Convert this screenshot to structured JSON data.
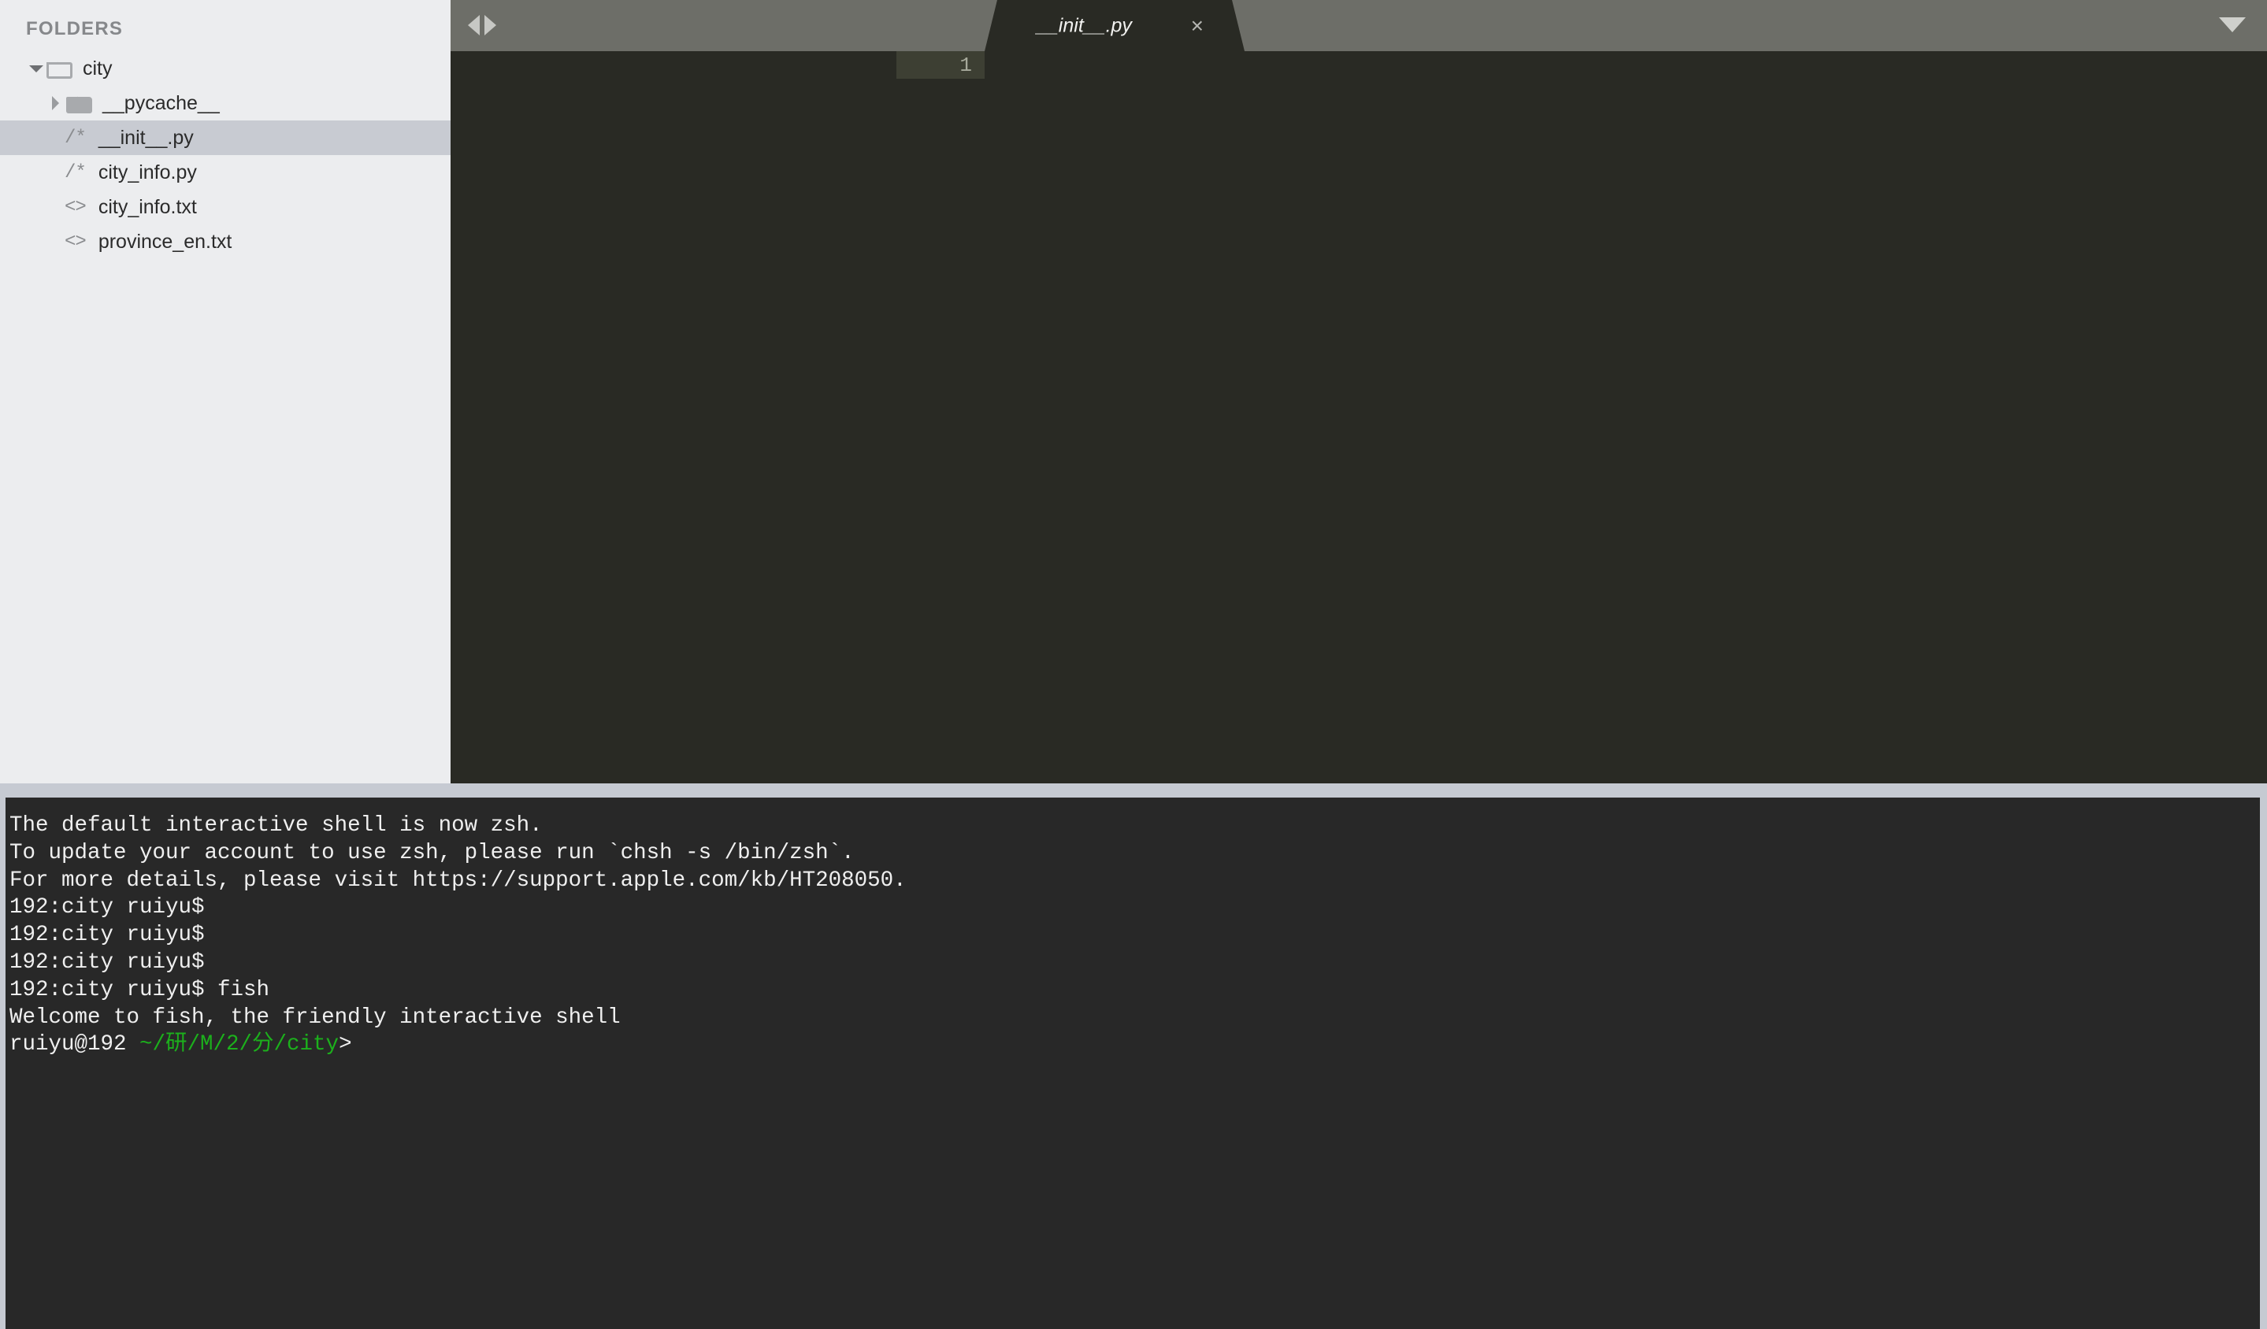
{
  "sidebar": {
    "header": "FOLDERS",
    "tree": [
      {
        "label": "city",
        "type": "folder",
        "state": "open",
        "indent": 1,
        "icon": "folder-open-icon",
        "selected": false
      },
      {
        "label": "__pycache__",
        "type": "folder",
        "state": "closed",
        "indent": 2,
        "icon": "folder-closed-icon",
        "selected": false
      },
      {
        "label": "__init__.py",
        "type": "file",
        "glyph": "/*",
        "indent": 3,
        "icon": "python-file-icon",
        "selected": true
      },
      {
        "label": "city_info.py",
        "type": "file",
        "glyph": "/*",
        "indent": 3,
        "icon": "python-file-icon",
        "selected": false
      },
      {
        "label": "city_info.txt",
        "type": "file",
        "glyph": "<>",
        "indent": 3,
        "icon": "text-file-icon",
        "selected": false
      },
      {
        "label": "province_en.txt",
        "type": "file",
        "glyph": "<>",
        "indent": 3,
        "icon": "text-file-icon",
        "selected": false
      }
    ]
  },
  "tabbar": {
    "nav_back_icon": "arrow-left-icon",
    "nav_forward_icon": "arrow-right-icon",
    "menu_icon": "chevron-down-icon",
    "tabs": [
      {
        "label": "__init__.py",
        "active": true,
        "close_glyph": "×"
      }
    ]
  },
  "editor": {
    "gutter": {
      "line_number": "1"
    },
    "content": ""
  },
  "terminal": {
    "lines": [
      {
        "segments": [
          {
            "text": "The default interactive shell is now zsh.",
            "color": "white"
          }
        ]
      },
      {
        "segments": [
          {
            "text": "To update your account to use zsh, please run `chsh -s /bin/zsh`.",
            "color": "white"
          }
        ]
      },
      {
        "segments": [
          {
            "text": "For more details, please visit https://support.apple.com/kb/HT208050.",
            "color": "white"
          }
        ]
      },
      {
        "segments": [
          {
            "text": "192:city ruiyu$ ",
            "color": "white"
          }
        ]
      },
      {
        "segments": [
          {
            "text": "192:city ruiyu$ ",
            "color": "white"
          }
        ]
      },
      {
        "segments": [
          {
            "text": "192:city ruiyu$ ",
            "color": "white"
          }
        ]
      },
      {
        "segments": [
          {
            "text": "192:city ruiyu$ fish",
            "color": "white"
          }
        ]
      },
      {
        "segments": [
          {
            "text": "Welcome to fish, the friendly interactive shell",
            "color": "white"
          }
        ]
      },
      {
        "segments": [
          {
            "text": "ruiyu@192 ",
            "color": "white"
          },
          {
            "text": "~/研/M/2/分/city",
            "color": "green"
          },
          {
            "text": ">",
            "color": "white"
          }
        ]
      }
    ]
  },
  "colors": {
    "sidebar_bg": "#ECEDEF",
    "sidebar_selected": "#C8CBD2",
    "tabbar_bg": "#6D6E68",
    "editor_bg": "#292A24",
    "gutter_highlight": "#3D3F33",
    "divider": "#C6CAD2",
    "terminal_bg": "#282828",
    "terminal_fg": "#EFEFEF",
    "terminal_green": "#1CB01C"
  }
}
